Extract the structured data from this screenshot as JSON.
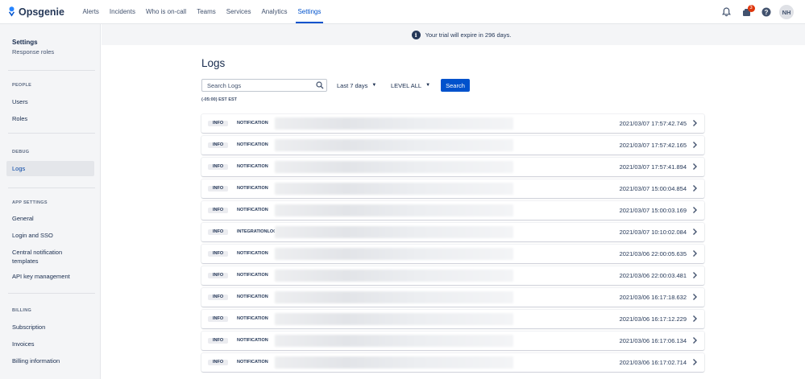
{
  "app": {
    "brand": "Opsgenie",
    "brand_color": "#0052cc"
  },
  "nav": {
    "items": [
      {
        "label": "Alerts",
        "active": false
      },
      {
        "label": "Incidents",
        "active": false
      },
      {
        "label": "Who is on-call",
        "active": false
      },
      {
        "label": "Teams",
        "active": false
      },
      {
        "label": "Services",
        "active": false
      },
      {
        "label": "Analytics",
        "active": false
      },
      {
        "label": "Settings",
        "active": true
      }
    ],
    "notification_count": "3",
    "user_initials": "NH",
    "icons": [
      "bell-icon",
      "notification-icon",
      "help-icon"
    ]
  },
  "banner": {
    "text": "Your trial will expire in 296 days."
  },
  "sidebar": {
    "title": "Settings",
    "subtitle": "Response roles",
    "sections": [
      {
        "label": "PEOPLE",
        "items": [
          "Users",
          "Roles"
        ]
      },
      {
        "label": "DEBUG",
        "items": [
          "Logs"
        ]
      },
      {
        "label": "APP SETTINGS",
        "items": [
          "General",
          "Login and SSO",
          "Central notification templates",
          "API key management"
        ]
      },
      {
        "label": "BILLING",
        "items": [
          "Subscription",
          "Invoices",
          "Billing information"
        ]
      }
    ],
    "selected": "Logs"
  },
  "main": {
    "title": "Logs",
    "search_placeholder": "Search Logs",
    "time_filter": "Last 7 days",
    "level_filter": "LEVEL ALL",
    "search_button": "Search",
    "timezone": "(-05:00) EST EST"
  },
  "logs": [
    {
      "level": "INFO",
      "type": "NOTIFICATION",
      "timestamp": "2021/03/07 17:57:42.745"
    },
    {
      "level": "INFO",
      "type": "NOTIFICATION",
      "timestamp": "2021/03/07 17:57:42.165"
    },
    {
      "level": "INFO",
      "type": "NOTIFICATION",
      "timestamp": "2021/03/07 17:57:41.894"
    },
    {
      "level": "INFO",
      "type": "NOTIFICATION",
      "timestamp": "2021/03/07 15:00:04.854"
    },
    {
      "level": "INFO",
      "type": "NOTIFICATION",
      "timestamp": "2021/03/07 15:00:03.169"
    },
    {
      "level": "INFO",
      "type": "INTEGRATIONLOG",
      "timestamp": "2021/03/07 10:10:02.084"
    },
    {
      "level": "INFO",
      "type": "NOTIFICATION",
      "timestamp": "2021/03/06 22:00:05.635"
    },
    {
      "level": "INFO",
      "type": "NOTIFICATION",
      "timestamp": "2021/03/06 22:00:03.481"
    },
    {
      "level": "INFO",
      "type": "NOTIFICATION",
      "timestamp": "2021/03/06 16:17:18.632"
    },
    {
      "level": "INFO",
      "type": "NOTIFICATION",
      "timestamp": "2021/03/06 16:17:12.229"
    },
    {
      "level": "INFO",
      "type": "NOTIFICATION",
      "timestamp": "2021/03/06 16:17:06.134"
    },
    {
      "level": "INFO",
      "type": "NOTIFICATION",
      "timestamp": "2021/03/06 16:17:02.714"
    }
  ]
}
